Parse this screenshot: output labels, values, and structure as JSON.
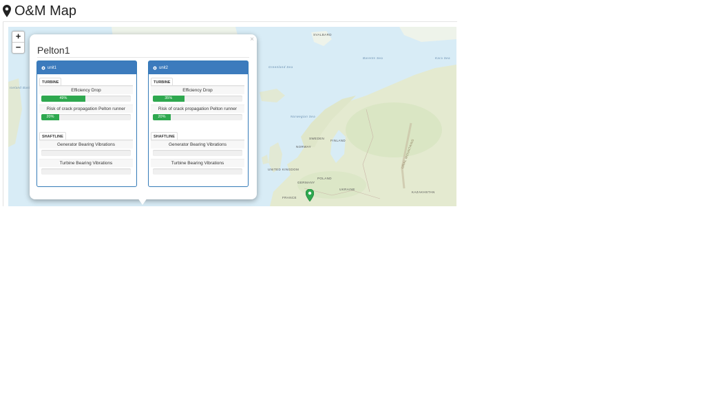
{
  "page": {
    "title": "O&M Map",
    "title_icon": "map-marker-icon"
  },
  "map": {
    "zoom_in_label": "+",
    "zoom_out_label": "−",
    "marker_color": "#2ea84f",
    "labels": {
      "svalbard": "SVALBARD",
      "greenland_sea": "Greenland Sea",
      "barents_sea": "Barents Sea",
      "kara_sea": "Kara Sea",
      "norwegian_sea": "Norwegian Sea",
      "sweden": "SWEDEN",
      "finland": "FINLAND",
      "norway": "NORWAY",
      "united_kingdom": "UNITED KINGDOM",
      "germany": "GERMANY",
      "poland": "POLAND",
      "ukraine": "UKRAINE",
      "france": "FRANCE",
      "kazakhstan": "KAZAKHSTAN",
      "ural_mountains": "URAL MOUNTAINS",
      "iceland_basin": "Iceland Basin"
    }
  },
  "popup": {
    "title": "Pelton1",
    "close_label": "×",
    "units": [
      {
        "name": "unit1",
        "turbine_label": "TURBINE",
        "turbine_metrics": [
          {
            "label": "Efficiency Drop",
            "percent": 49,
            "text": "49%"
          },
          {
            "label": "Risk of crack propagation Pelton runner",
            "percent": 20,
            "text": "20%"
          }
        ],
        "shaftline_label": "SHAFTLINE",
        "shaftline_metrics": [
          {
            "label": "Generator Bearing Vibrations",
            "percent": 0,
            "text": ""
          },
          {
            "label": "Turbine Bearing Vibrations",
            "percent": 0,
            "text": ""
          }
        ]
      },
      {
        "name": "unit2",
        "turbine_label": "TURBINE",
        "turbine_metrics": [
          {
            "label": "Efficiency Drop",
            "percent": 35,
            "text": "35%"
          },
          {
            "label": "Risk of crack propagation Pelton runner",
            "percent": 20,
            "text": "20%"
          }
        ],
        "shaftline_label": "SHAFTLINE",
        "shaftline_metrics": [
          {
            "label": "Generator Bearing Vibrations",
            "percent": 0,
            "text": ""
          },
          {
            "label": "Turbine Bearing Vibrations",
            "percent": 0,
            "text": ""
          }
        ]
      }
    ]
  },
  "colors": {
    "header_blue": "#3c7bbd",
    "progress_green": "#2ea84f",
    "sea": "#d8ecf6",
    "land": "#e6ecd2"
  }
}
